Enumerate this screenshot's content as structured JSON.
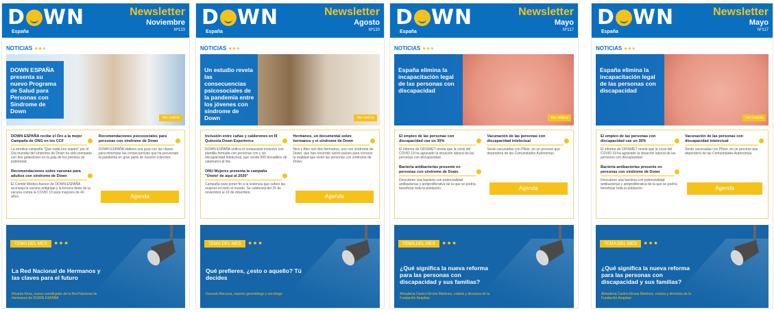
{
  "logo": {
    "text_left": "D",
    "text_right": "WN",
    "sub": "España"
  },
  "newsletter_label": "Newsletter",
  "noticias_label": "NOTICIAS",
  "tema_label": "TEMA DEL MES",
  "agenda_label": "Agenda",
  "ver_label": "Ver noticia",
  "colors": {
    "brand_blue": "#0b6fc0",
    "accent_yellow": "#f5c21a",
    "tema_blue": "#1565a8"
  },
  "panels": [
    {
      "month": "Noviembre",
      "number": "Nº123",
      "hero_title": "DOWN ESPAÑA presenta su nuevo Programa de Salud para Personas con Síndrome de Down",
      "news_left": [
        {
          "title": "DOWN ESPAÑA recibe el Oro a la mejor Campaña de ONG en los CCF",
          "text": "La emotiva campaña \"Que nada nos separe\" por el Día mundial del síndrome de Down ha sido premiada con dos galardones en la gala de los premios de publicidad."
        },
        {
          "title": "Recomendaciones sobre vacunas para adultos con síndrome de Down",
          "text": "El Comité Médico Asesor de DOWN ESPAÑA aconseja la vacuna antigripal y la tercera dosis de la vacuna contra la COVID 19 para mayores de 40 años."
        }
      ],
      "news_right": [
        {
          "title": "Recomendaciones psicosociales para personas con síndrome de Down",
          "text": "DOWN ESPAÑA elabora una guía con las claves para minimizar las consecuencias que ha provocado la pandemia en gran parte de nuestro colectivo."
        }
      ],
      "tema_title": "La Red Nacional de Hermanos y las claves para el futuro",
      "tema_author": "Ricardo Ariza, nuevo coordinador de la Red Nacional de Hermanos de DOWN ESPAÑA"
    },
    {
      "month": "Agosto",
      "number": "Nº120",
      "hero_title": "Un estudio revela las consecuencias psicosociales de la pandemia entre los jóvenes con síndrome de Down",
      "news_left": [
        {
          "title": "Inclusión entre cañas y calderones en III Quinoxia Down Experience",
          "text": "DOWN ESPAÑA unifica el restaurante inclusivo con plantilla formada con personas con y sin discapacidad intelectual, que vende 500 bocadillos de calamares al día."
        },
        {
          "title": "ONU Mujeres presenta la campaña \"Únete! de aquí al 2030\"",
          "text": "Campaña para poner fin a la violencia que sufren las mujeres en todo el mundo. Se celebrará del 25 de noviembre al 10 de diciembre."
        }
      ],
      "news_right": [
        {
          "title": "Hermanos, un documental sobre hermanos y el síndrome de Down",
          "text": "Nico y Alex son dos hermanos, uno con síndrome de Down, que han recorrido varios países para conocer la realidad que viven las personas con síndrome de Down."
        }
      ],
      "tema_title": "Qué prefieres, ¿esto o aquello? Tú decides",
      "tema_author": "Gonzalo Berzosa, experto gerontólogo y sociólogo"
    },
    {
      "month": "Mayo",
      "number": "Nº117",
      "hero_title": "España elimina la incapacitación legal de las personas con discapacidad",
      "news_left": [
        {
          "title": "El empleo de las personas con discapacidad cae un 30%",
          "text": "El informe de ODISMET revela que la crisis del COVID 19 ha agravado la situación laboral de las personas con discapacidad."
        },
        {
          "title": "Bacteria antibacterias presente en personas con síndrome de Down",
          "text": "Descubren una bacteria con potencialidad antibacterias y antiproliferativa de la que se podría beneficiar toda la población."
        }
      ],
      "news_right": [
        {
          "title": "Vacunación de las personas con discapacidad intelectual",
          "text": "Serán vacunadas con Pfizer, en un proceso que dependerá de las Comunidades Autónomas."
        }
      ],
      "tema_title": "¿Qué significa la nueva reforma para las personas con discapacidad y sus familias?",
      "tema_author": "Almudena Castro-Girona Martínez, notaria y directora de la Fundación Aequitas"
    },
    {
      "month": "Mayo",
      "number": "Nº117",
      "hero_title": "España elimina la incapacitación legal de las personas con discapacidad",
      "news_left": [
        {
          "title": "El empleo de las personas con discapacidad cae un 30%",
          "text": "El informe de ODISMET revela que la crisis del COVID 19 ha agravado la situación laboral de las personas con discapacidad."
        },
        {
          "title": "Bacteria antibacterias presente en personas con síndrome de Down",
          "text": "Descubren una bacteria con potencialidad antibacterias y antiproliferativa de la que se podría beneficiar toda la población."
        }
      ],
      "news_right": [
        {
          "title": "Vacunación de las personas con discapacidad intelectual",
          "text": "Serán vacunadas con Pfizer, en un proceso que dependerá de las Comunidades Autónomas."
        }
      ],
      "tema_title": "¿Qué significa la nueva reforma para las personas con discapacidad y sus familias?",
      "tema_author": "Almudena Castro-Girona Martínez, notaria y directora de la Fundación Aequitas"
    }
  ]
}
